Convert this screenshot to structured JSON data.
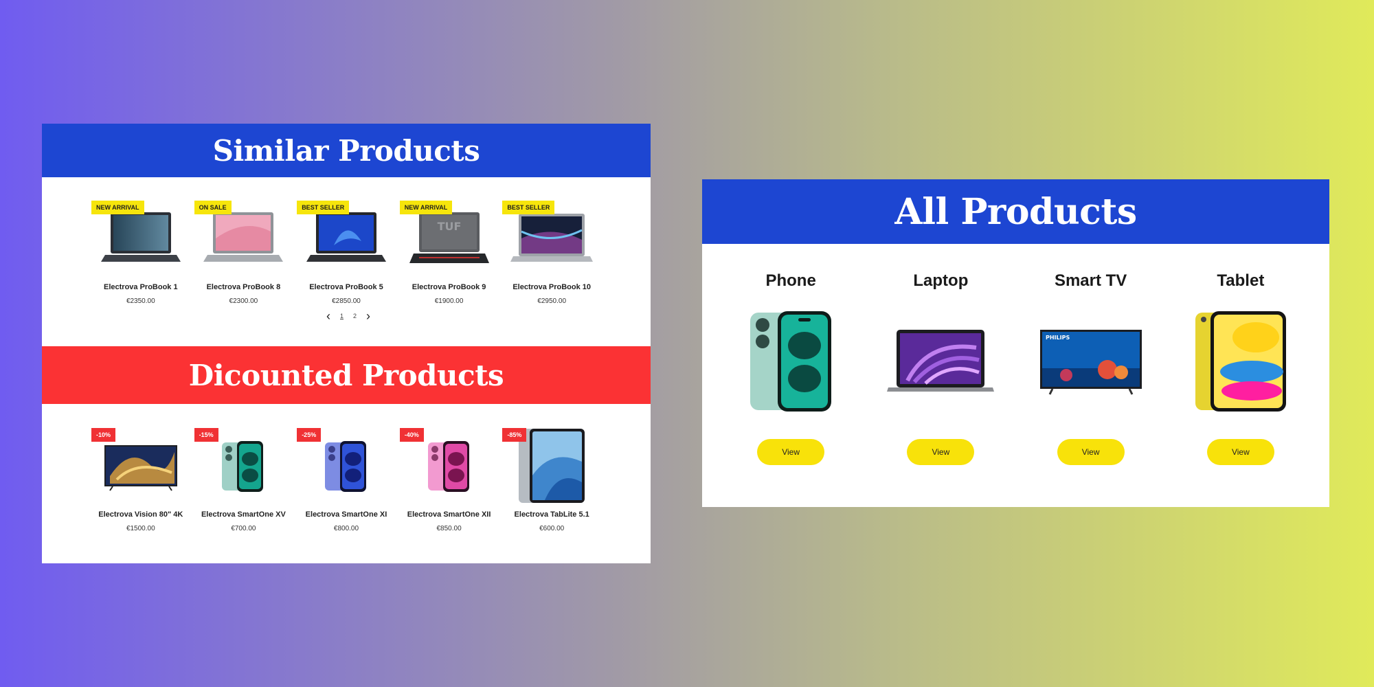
{
  "similar": {
    "title": "Similar Products",
    "items": [
      {
        "badge": "NEW ARRIVAL",
        "name": "Electrova ProBook 1",
        "price": "€2350.00",
        "icon": "laptop-icon"
      },
      {
        "badge": "ON SALE",
        "name": "Electrova ProBook 8",
        "price": "€2300.00",
        "icon": "laptop-icon"
      },
      {
        "badge": "BEST SELLER",
        "name": "Electrova ProBook 5",
        "price": "€2850.00",
        "icon": "laptop-icon"
      },
      {
        "badge": "NEW ARRIVAL",
        "name": "Electrova ProBook 9",
        "price": "€1900.00",
        "icon": "laptop-icon"
      },
      {
        "badge": "BEST SELLER",
        "name": "Electrova ProBook 10",
        "price": "€2950.00",
        "icon": "laptop-icon"
      }
    ],
    "pager": {
      "prev": "‹",
      "pages": [
        "1",
        "2"
      ],
      "next": "›"
    }
  },
  "discounted": {
    "title": "Dicounted Products",
    "items": [
      {
        "badge": "-10%",
        "name": "Electrova Vision 80\" 4K",
        "price": "€1500.00",
        "icon": "tv-icon"
      },
      {
        "badge": "-15%",
        "name": "Electrova SmartOne XV",
        "price": "€700.00",
        "icon": "phone-icon"
      },
      {
        "badge": "-25%",
        "name": "Electrova SmartOne XI",
        "price": "€800.00",
        "icon": "phone-icon"
      },
      {
        "badge": "-40%",
        "name": "Electrova SmartOne XII",
        "price": "€850.00",
        "icon": "phone-icon"
      },
      {
        "badge": "-85%",
        "name": "Electrova TabLite 5.1",
        "price": "€600.00",
        "icon": "tablet-icon"
      }
    ]
  },
  "all": {
    "title": "All Products",
    "categories": [
      {
        "title": "Phone",
        "button": "View",
        "icon": "phone-icon"
      },
      {
        "title": "Laptop",
        "button": "View",
        "icon": "laptop-icon"
      },
      {
        "title": "Smart TV",
        "button": "View",
        "icon": "tv-icon"
      },
      {
        "title": "Tablet",
        "button": "View",
        "icon": "tablet-icon"
      }
    ]
  },
  "colors": {
    "header_blue": "#1d46d2",
    "header_red": "#fb3234",
    "badge_yellow": "#f6e50c",
    "badge_red": "#f03134",
    "button_yellow": "#f8e20a"
  }
}
